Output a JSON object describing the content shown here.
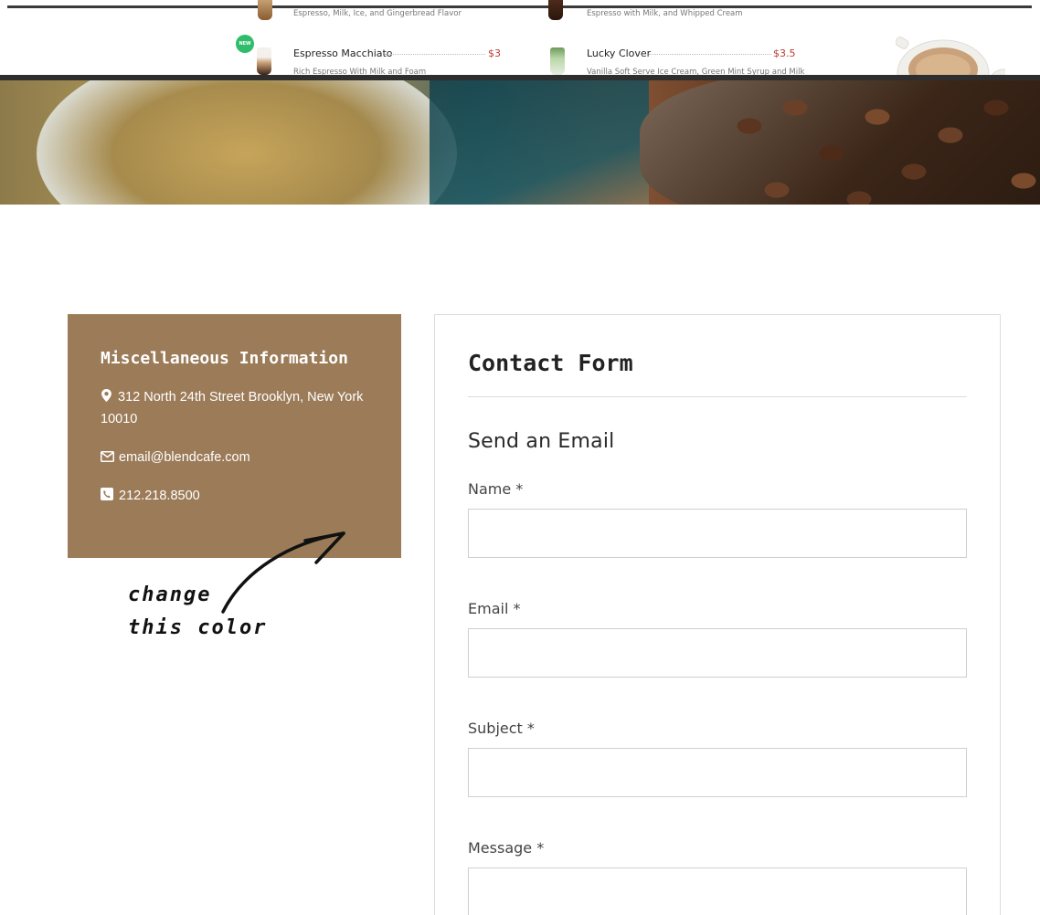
{
  "menu": {
    "items": [
      {
        "name": "",
        "price": "",
        "desc": "Espresso, Milk, Ice, and Gingerbread Flavor"
      },
      {
        "name": "",
        "price": "",
        "desc": "Espresso with Milk, and Whipped Cream"
      },
      {
        "name": "Espresso Macchiato",
        "price": "$3",
        "desc": "Rich Espresso With Milk and Foam",
        "badge": "NEW"
      },
      {
        "name": "Lucky Clover",
        "price": "$3.5",
        "desc": "Vanilla Soft Serve Ice Cream, Green Mint Syrup and Milk"
      }
    ]
  },
  "info": {
    "title": "Miscellaneous Information",
    "address": "312 North 24th Street Brooklyn, New York 10010",
    "email": "email@blendcafe.com",
    "phone": "212.218.8500",
    "background_color": "#9b7b58"
  },
  "annotation": {
    "line1": "change",
    "line2": "this color"
  },
  "form": {
    "title": "Contact Form",
    "subtitle": "Send an Email",
    "fields": [
      {
        "label": "Name *",
        "value": ""
      },
      {
        "label": "Email *",
        "value": ""
      },
      {
        "label": "Subject *",
        "value": ""
      },
      {
        "label": "Message *",
        "value": ""
      }
    ]
  }
}
